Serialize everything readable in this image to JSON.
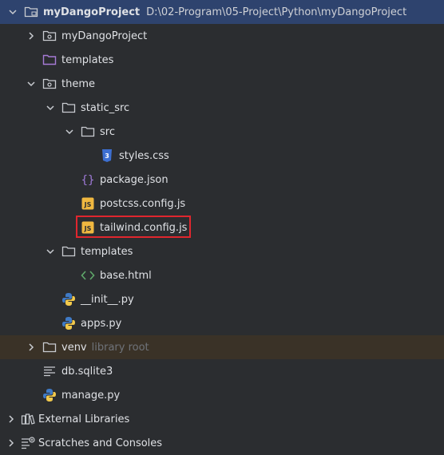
{
  "colors": {
    "background": "#2b2d30",
    "selection": "#2e436e",
    "text": "#dfe1e5",
    "muted": "#6f737a",
    "folder_outline": "#c9ccd1",
    "templates_folder": "#a67bd6",
    "venv_row": "#3a3227",
    "highlight_box": "#e0262e",
    "js_badge": "#f0b840",
    "css_badge": "#3d6fd1",
    "json_brace": "#9f7ad8",
    "html_tag": "#5fa86a",
    "python_blue": "#3f7ac6",
    "python_yellow": "#f2c94c"
  },
  "tree": {
    "root": {
      "name": "myDangoProject",
      "path": "D:\\02-Program\\05-Project\\Python\\myDangoProject"
    },
    "items": {
      "pkg_myDangoProject": "myDangoProject",
      "templates_root": "templates",
      "theme": "theme",
      "static_src": "static_src",
      "src": "src",
      "styles_css": "styles.css",
      "package_json": "package.json",
      "postcss_config": "postcss.config.js",
      "tailwind_config": "tailwind.config.js",
      "theme_templates": "templates",
      "base_html": "base.html",
      "init_py": "__init__.py",
      "apps_py": "apps.py",
      "venv": "venv",
      "venv_hint": "library root",
      "db_sqlite": "db.sqlite3",
      "manage_py": "manage.py",
      "external_libraries": "External Libraries",
      "scratches": "Scratches and Consoles"
    }
  }
}
